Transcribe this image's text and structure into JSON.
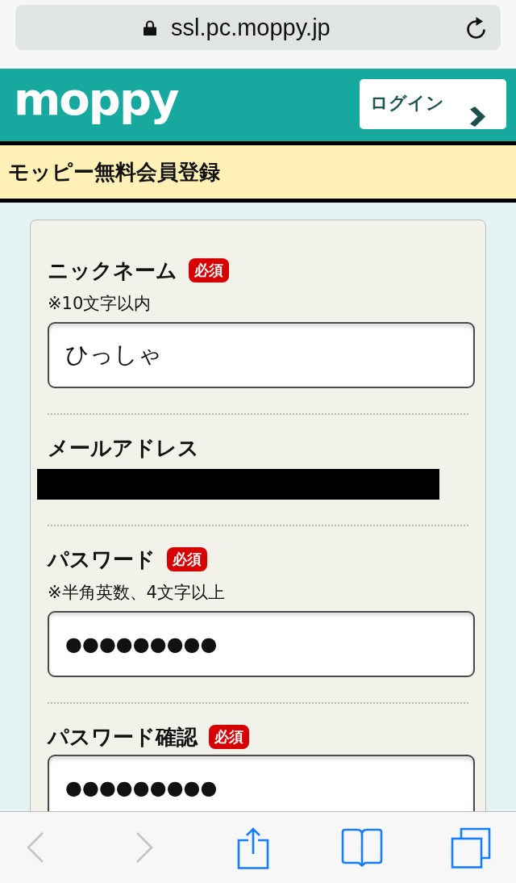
{
  "browser": {
    "url": "ssl.pc.moppy.jp"
  },
  "header": {
    "logo": "moppy",
    "login_button": "ログイン"
  },
  "page_title": "モッピー無料会員登録",
  "form": {
    "fields": [
      {
        "label": "ニックネーム",
        "badge": "必須",
        "hint": "※10文字以内",
        "kind": "text",
        "value": "ひっしゃ"
      },
      {
        "label": "メールアドレス",
        "kind": "redacted"
      },
      {
        "label": "パスワード",
        "badge": "必須",
        "hint": "※半角英数、4文字以上",
        "kind": "password",
        "value": "●●●●●●●●●"
      },
      {
        "label": "パスワード確認",
        "badge": "必須",
        "kind": "password",
        "value": "●●●●●●●●●"
      }
    ]
  },
  "toolbar": {
    "buttons": [
      {
        "kind": "back",
        "disabled": true
      },
      {
        "kind": "forward",
        "disabled": true
      },
      {
        "kind": "share",
        "disabled": false
      },
      {
        "kind": "bookmarks",
        "disabled": false
      },
      {
        "kind": "tabs",
        "disabled": false
      }
    ]
  }
}
